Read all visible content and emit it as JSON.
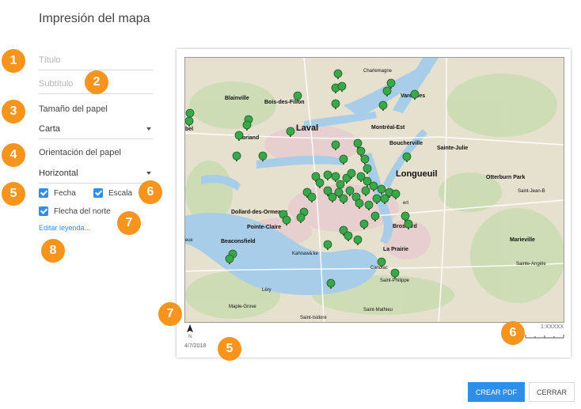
{
  "dialog": {
    "title": "Impresión del mapa"
  },
  "form": {
    "title_placeholder": "Título",
    "subtitle_placeholder": "Subtítulo",
    "paper_size_label": "Tamaño del papel",
    "paper_size_value": "Carta",
    "orientation_label": "Orientación del papel",
    "orientation_value": "Horizontal",
    "date_label": "Fecha",
    "scale_label": "Escala",
    "north_arrow_label": "Flecha del norte",
    "edit_legend_link": "Editar leyenda..."
  },
  "badges": [
    "1",
    "2",
    "3",
    "4",
    "5",
    "6",
    "7",
    "8",
    "7",
    "6",
    "5"
  ],
  "preview": {
    "date": "4/7/2018",
    "scale": "1:XXXXX",
    "north_letter": "N",
    "places": {
      "laval": "Laval",
      "longueuil": "Longueuil",
      "montreal_est": "Montréal-Est",
      "boucherville": "Boucherville",
      "sainte_julie": "Sainte-Julie",
      "blainville": "Blainville",
      "bois_des_filion": "Bois-des-Filion",
      "charlemagne": "Charlemagne",
      "varennes": "Varennes",
      "boisbriand": "isbriand",
      "mirabel": "bel",
      "otterburn_park": "Otterburn Park",
      "saint_jean": "Saint-Jean-B",
      "dollard": "Dollard-des-Ormeaux",
      "pointe_claire": "Pointe-Claire",
      "beaconsfield": "Beaconsfield",
      "brossard": "Brossard",
      "la_prairie": "La Prairie",
      "marieville": "Marieville",
      "saint_angele": "Sainte-Angèle",
      "kahnawake": "Kahnawà:ke",
      "candiac": "Candiac",
      "saint_philippe": "Saint-Philippe",
      "lery": "Léry",
      "maple_grove": "Maple-Grove",
      "saint_mathieu": "Saint-Mathieu",
      "saint_isidore": "Saint-Isidore",
      "vaudreuil": "eux",
      "lambert": "ert"
    }
  },
  "buttons": {
    "create_pdf": "CREAR PDF",
    "close": "CERRAR"
  },
  "colors": {
    "accent": "#2f8fe6",
    "badge": "#f7941d",
    "water": "#a8cde8",
    "land": "#e6e0cf",
    "pin": "#3aa84a"
  }
}
